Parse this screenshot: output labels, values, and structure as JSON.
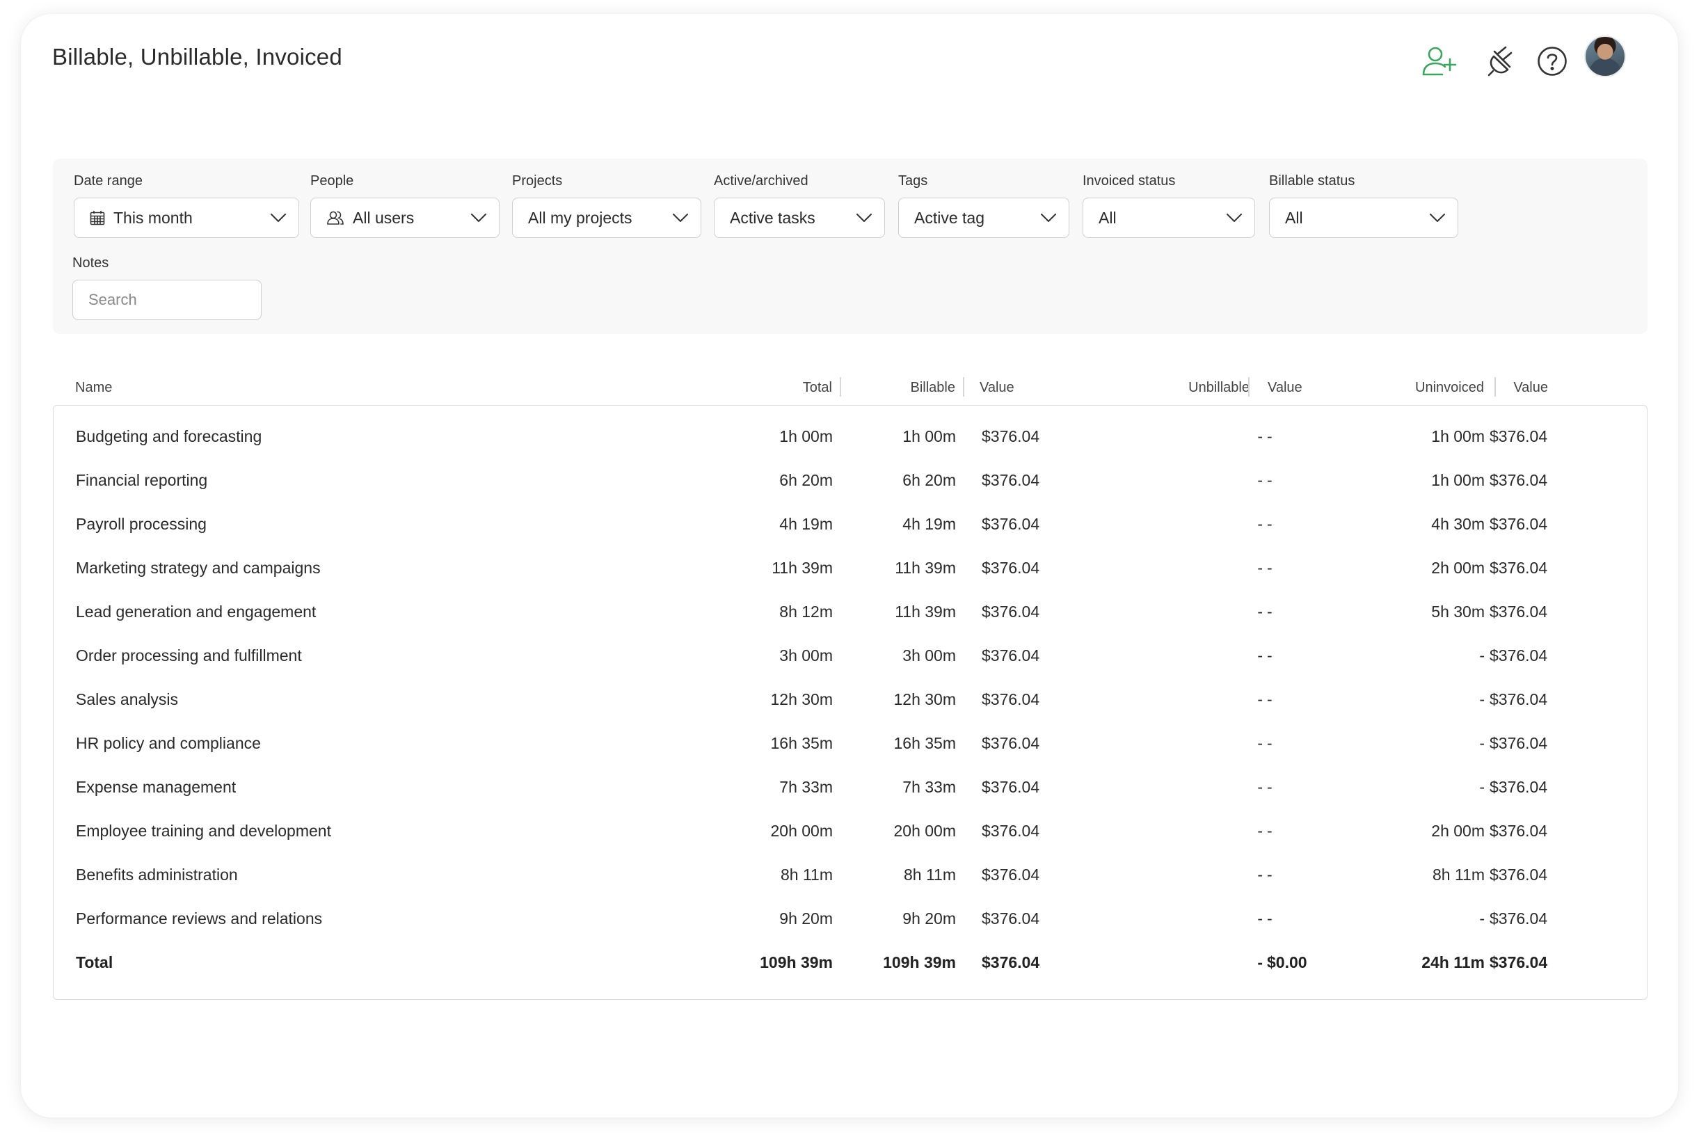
{
  "page_title": "Billable, Unbillable, Invoiced",
  "header_icons": {
    "add_user": "add-user-icon",
    "integrations": "plug-icon",
    "help": "help-icon",
    "avatar": "avatar"
  },
  "colors": {
    "accent": "#3aa55c",
    "text": "#2a2a2a",
    "border": "#cfcfcf",
    "filter_bg": "#f8f8f8"
  },
  "filters": {
    "date_range": {
      "label": "Date range",
      "value": "This month",
      "icon": "calendar-icon"
    },
    "people": {
      "label": "People",
      "value": "All users",
      "icon": "users-icon"
    },
    "projects": {
      "label": "Projects",
      "value": "All my projects"
    },
    "active_archived": {
      "label": "Active/archived",
      "value": "Active tasks"
    },
    "tags": {
      "label": "Tags",
      "value": "Active tag"
    },
    "invoiced_status": {
      "label": "Invoiced status",
      "value": "All"
    },
    "billable_status": {
      "label": "Billable status",
      "value": "All"
    },
    "notes": {
      "label": "Notes",
      "placeholder": "Search",
      "value": ""
    }
  },
  "table": {
    "columns": {
      "name": "Name",
      "total": "Total",
      "billable": "Billable",
      "billable_value": "Value",
      "unbillable": "Unbillable",
      "unbillable_value": "Value",
      "uninvoiced": "Uninvoiced",
      "uninvoiced_value": "Value"
    },
    "rows": [
      {
        "name": "Budgeting and forecasting",
        "total": "1h 00m",
        "billable": "1h 00m",
        "billable_value": "$376.04",
        "unbillable": "-",
        "unbillable_value": "-",
        "uninvoiced": "1h 00m",
        "uninvoiced_value": "$376.04"
      },
      {
        "name": "Financial reporting",
        "total": "6h 20m",
        "billable": "6h 20m",
        "billable_value": "$376.04",
        "unbillable": "-",
        "unbillable_value": "-",
        "uninvoiced": "1h 00m",
        "uninvoiced_value": "$376.04"
      },
      {
        "name": "Payroll processing",
        "total": "4h 19m",
        "billable": "4h 19m",
        "billable_value": "$376.04",
        "unbillable": "-",
        "unbillable_value": "-",
        "uninvoiced": "4h 30m",
        "uninvoiced_value": "$376.04"
      },
      {
        "name": "Marketing strategy and campaigns",
        "total": "11h 39m",
        "billable": "11h 39m",
        "billable_value": "$376.04",
        "unbillable": "-",
        "unbillable_value": "-",
        "uninvoiced": "2h 00m",
        "uninvoiced_value": "$376.04"
      },
      {
        "name": "Lead generation and engagement",
        "total": "8h 12m",
        "billable": "11h 39m",
        "billable_value": "$376.04",
        "unbillable": "-",
        "unbillable_value": "-",
        "uninvoiced": "5h 30m",
        "uninvoiced_value": "$376.04"
      },
      {
        "name": "Order processing and fulfillment",
        "total": "3h 00m",
        "billable": "3h 00m",
        "billable_value": "$376.04",
        "unbillable": "-",
        "unbillable_value": "-",
        "uninvoiced": "-",
        "uninvoiced_value": "$376.04"
      },
      {
        "name": "Sales analysis",
        "total": "12h 30m",
        "billable": "12h 30m",
        "billable_value": "$376.04",
        "unbillable": "-",
        "unbillable_value": "-",
        "uninvoiced": "-",
        "uninvoiced_value": "$376.04"
      },
      {
        "name": "HR policy and compliance",
        "total": "16h 35m",
        "billable": "16h 35m",
        "billable_value": "$376.04",
        "unbillable": "-",
        "unbillable_value": "-",
        "uninvoiced": "-",
        "uninvoiced_value": "$376.04"
      },
      {
        "name": "Expense management",
        "total": "7h 33m",
        "billable": "7h 33m",
        "billable_value": "$376.04",
        "unbillable": "-",
        "unbillable_value": "-",
        "uninvoiced": "-",
        "uninvoiced_value": "$376.04"
      },
      {
        "name": "Employee training and development",
        "total": "20h 00m",
        "billable": "20h 00m",
        "billable_value": "$376.04",
        "unbillable": "-",
        "unbillable_value": "-",
        "uninvoiced": "2h 00m",
        "uninvoiced_value": "$376.04"
      },
      {
        "name": "Benefits administration",
        "total": "8h 11m",
        "billable": "8h 11m",
        "billable_value": "$376.04",
        "unbillable": "-",
        "unbillable_value": "-",
        "uninvoiced": "8h 11m",
        "uninvoiced_value": "$376.04"
      },
      {
        "name": "Performance reviews and relations",
        "total": "9h 20m",
        "billable": "9h 20m",
        "billable_value": "$376.04",
        "unbillable": "-",
        "unbillable_value": "-",
        "uninvoiced": "-",
        "uninvoiced_value": "$376.04"
      }
    ],
    "total_row": {
      "name": "Total",
      "total": "109h 39m",
      "billable": "109h 39m",
      "billable_value": "$376.04",
      "unbillable": "-",
      "unbillable_value": "$0.00",
      "uninvoiced": "24h 11m",
      "uninvoiced_value": "$376.04"
    }
  }
}
